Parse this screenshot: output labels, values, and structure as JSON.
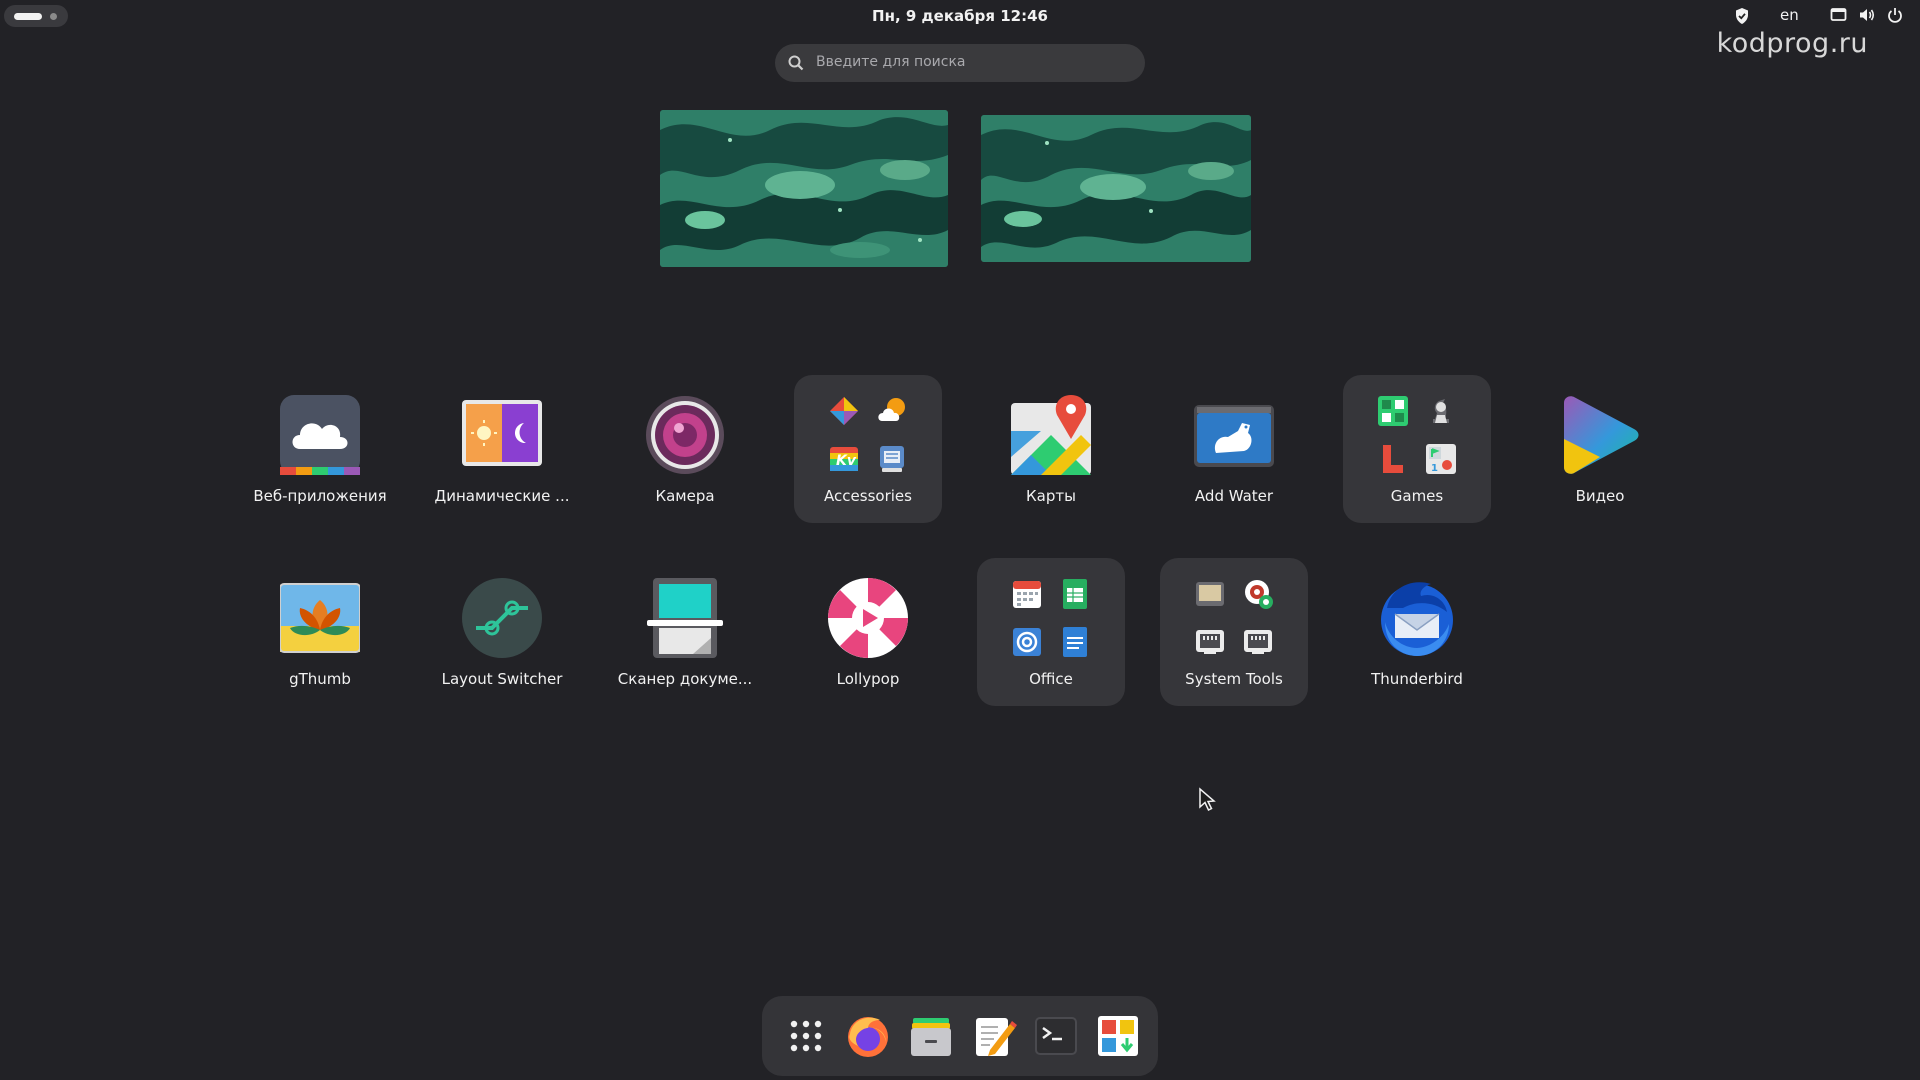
{
  "topbar": {
    "clock": "Пн, 9 декабря  12:46",
    "keyboard_layout": "en"
  },
  "watermark": "kodprog.ru",
  "search": {
    "placeholder": "Введите для поиска"
  },
  "workspaces": [
    "workspace-1",
    "workspace-2"
  ],
  "apps": [
    {
      "label": "Веб-приложения",
      "icon": "web-apps-icon",
      "folder": false
    },
    {
      "label": "Динамические ...",
      "icon": "dynamic-wallpaper-icon",
      "folder": false
    },
    {
      "label": "Камера",
      "icon": "camera-icon",
      "folder": false
    },
    {
      "label": "Accessories",
      "icon": "accessories-folder-icon",
      "folder": true
    },
    {
      "label": "Карты",
      "icon": "maps-icon",
      "folder": false
    },
    {
      "label": "Add Water",
      "icon": "add-water-icon",
      "folder": false
    },
    {
      "label": "Games",
      "icon": "games-folder-icon",
      "folder": true
    },
    {
      "label": "Видео",
      "icon": "video-icon",
      "folder": false
    },
    {
      "label": "gThumb",
      "icon": "gthumb-icon",
      "folder": false
    },
    {
      "label": "Layout Switcher",
      "icon": "layout-switcher-icon",
      "folder": false
    },
    {
      "label": "Сканер докуме...",
      "icon": "document-scanner-icon",
      "folder": false
    },
    {
      "label": "Lollypop",
      "icon": "lollypop-icon",
      "folder": false
    },
    {
      "label": "Office",
      "icon": "office-folder-icon",
      "folder": true
    },
    {
      "label": "System Tools",
      "icon": "system-tools-folder-icon",
      "folder": true
    },
    {
      "label": "Thunderbird",
      "icon": "thunderbird-icon",
      "folder": false
    }
  ],
  "dock": [
    "show-apps-icon",
    "firefox-icon",
    "files-icon",
    "text-editor-icon",
    "terminal-icon",
    "software-icon"
  ],
  "colors": {
    "background": "#222226",
    "folder_bg": "#36363a",
    "dock_bg": "#343438",
    "search_bg": "#3a3a3d"
  }
}
